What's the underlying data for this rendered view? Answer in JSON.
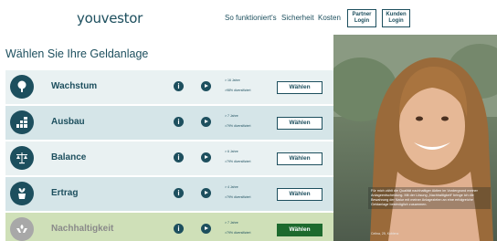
{
  "header": {
    "logo": "youvestor",
    "nav": [
      "So funktioniert's",
      "Sicherheit",
      "Kosten"
    ],
    "partner_login": [
      "Partner",
      "Login"
    ],
    "kunden_login": [
      "Kunden",
      "Login"
    ]
  },
  "main": {
    "heading": "Wählen Sie Ihre Geldanlage",
    "rows": [
      {
        "name": "Wachstum",
        "meta1": "> 16 Jahre",
        "meta2": ">98% diversifiziert",
        "button": "Wählen",
        "icon": "tree-icon"
      },
      {
        "name": "Ausbau",
        "meta1": "> 7 Jahre",
        "meta2": ">79% diversifiziert",
        "button": "Wählen",
        "icon": "bar-blocks-icon"
      },
      {
        "name": "Balance",
        "meta1": "> 6 Jahre",
        "meta2": ">79% diversifiziert",
        "button": "Wählen",
        "icon": "scale-icon"
      },
      {
        "name": "Ertrag",
        "meta1": "> 4 Jahre",
        "meta2": ">79% diversifiziert",
        "button": "Wählen",
        "icon": "plant-pot-icon"
      },
      {
        "name": "Nachhaltigkeit",
        "meta1": "> 7 Jahre",
        "meta2": ">79% diversifiziert",
        "button": "Wählen",
        "icon": "hands-leaf-icon"
      }
    ]
  },
  "testimonial": {
    "quote": "Für mich zählt die Qualität nachhaltiger Aktien im Vordergrund meiner Anlageentscheidung. Mit der Lösung „Nachhaltigkeit“ bringe ich die Bewahrung der Natur mit meiner Anlagezielen an eine erfolgreiche Geldanlage bestmöglich zusammen.",
    "author": "Celina, 25, Koblenz"
  },
  "colors": {
    "brand": "#1d4f5e",
    "row_light": "#e9f1f2",
    "row_mid": "#d5e5e8",
    "row_active": "#cfe0b8",
    "active_button": "#1d6a2e"
  }
}
